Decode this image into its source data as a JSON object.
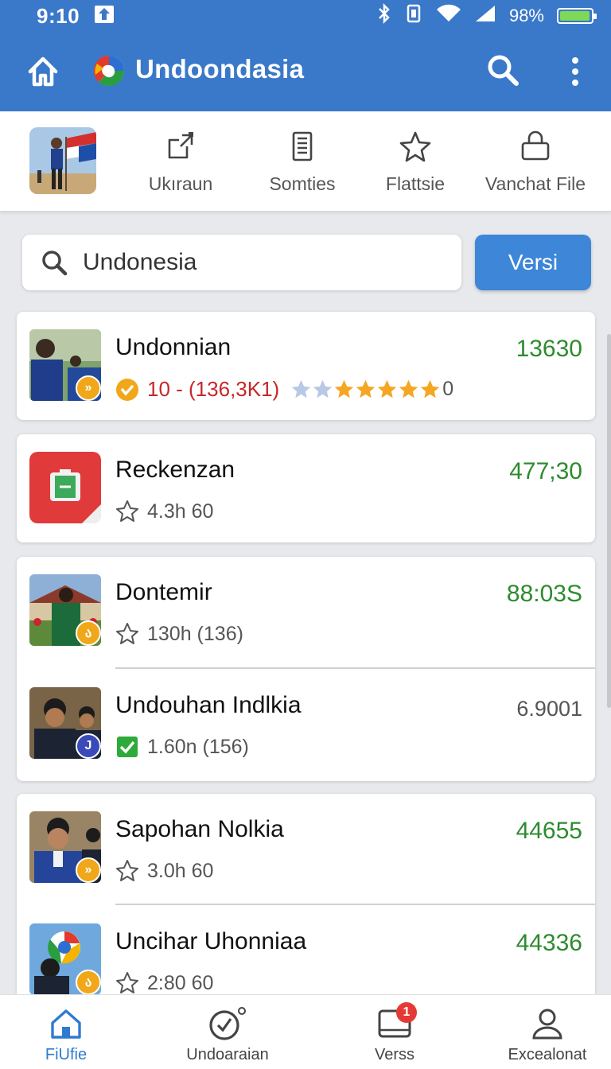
{
  "status_bar": {
    "time": "9:10",
    "battery": "98%",
    "battery_level": 0.98
  },
  "app_bar": {
    "title": "Undoondasia"
  },
  "tabs": [
    {
      "label": "Ukıraun",
      "icon": "share-export-icon"
    },
    {
      "label": "Somties",
      "icon": "document-list-icon"
    },
    {
      "label": "Flattsie",
      "icon": "star-outline-icon"
    },
    {
      "label": "Vanchat File",
      "icon": "lock-box-icon"
    }
  ],
  "search": {
    "value": "Undonesia",
    "button_label": "Versi"
  },
  "items": [
    {
      "name": "Undonnian",
      "value": "13630",
      "rating_text": "10 - (136,3K1)",
      "rating_suffix": "0",
      "stars": 4.5
    },
    {
      "name": "Reckenzan",
      "value": "477;30",
      "meta": "4.3h 60"
    },
    {
      "name": "Dontemir",
      "value": "88:03S",
      "meta": "130h (136)"
    },
    {
      "name": "Undouhan Indlkia",
      "value": "6.9001",
      "meta": "1.60n (156)"
    },
    {
      "name": "Sapohan Nolkia",
      "value": "44655",
      "meta": "3.0h 60"
    },
    {
      "name": "Uncihar Uhonniaa",
      "value": "44336",
      "meta": "2:80 60"
    }
  ],
  "bottom_nav": [
    {
      "label": "FiUfie",
      "icon": "home-icon",
      "active": true
    },
    {
      "label": "Undoaraian",
      "icon": "check-circle-icon"
    },
    {
      "label": "Verss",
      "icon": "tablet-icon",
      "badge": "1"
    },
    {
      "label": "Excealonat",
      "icon": "person-icon"
    }
  ],
  "colors": {
    "primary": "#3a78c9",
    "accent_button": "#3d86d8",
    "value_green": "#2e8b2e",
    "star": "#f5a623"
  }
}
